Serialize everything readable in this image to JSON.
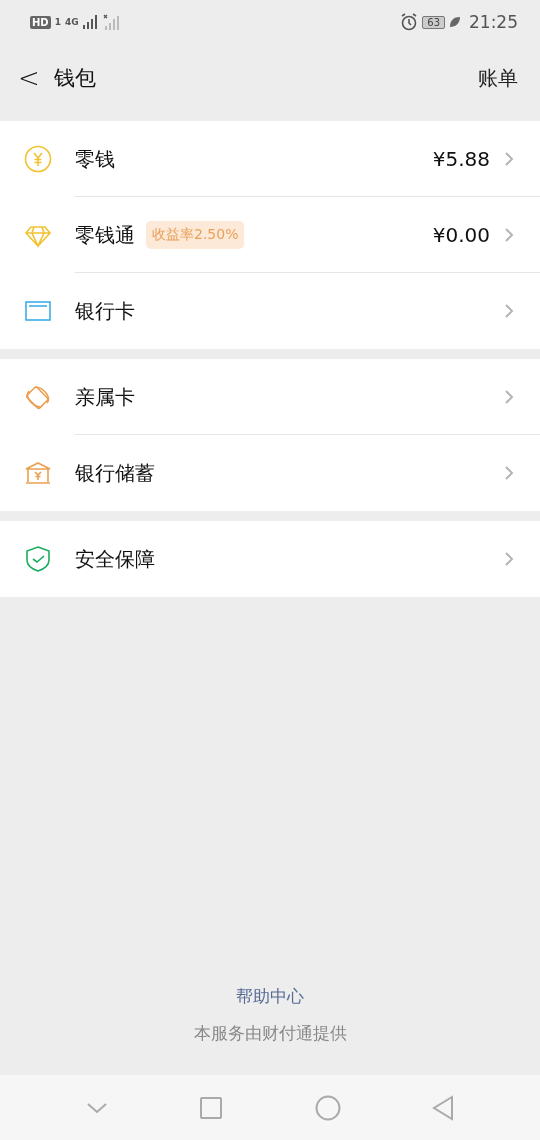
{
  "status_bar": {
    "hd": "HD",
    "sim": "1",
    "network": "4G",
    "battery": "63",
    "time": "21:25"
  },
  "header": {
    "back": "<",
    "title": "钱包",
    "action": "账单"
  },
  "groups": [
    {
      "items": [
        {
          "kind": "coin",
          "label": "零钱",
          "value": "¥5.88"
        },
        {
          "kind": "diamond",
          "label": "零钱通",
          "badge": "收益率2.50%",
          "value": "¥0.00"
        },
        {
          "kind": "card",
          "label": "银行卡"
        }
      ]
    },
    {
      "items": [
        {
          "kind": "family",
          "label": "亲属卡"
        },
        {
          "kind": "bank",
          "label": "银行储蓄"
        }
      ]
    },
    {
      "items": [
        {
          "kind": "shield",
          "label": "安全保障"
        }
      ]
    }
  ],
  "footer": {
    "link": "帮助中心",
    "note": "本服务由财付通提供"
  }
}
